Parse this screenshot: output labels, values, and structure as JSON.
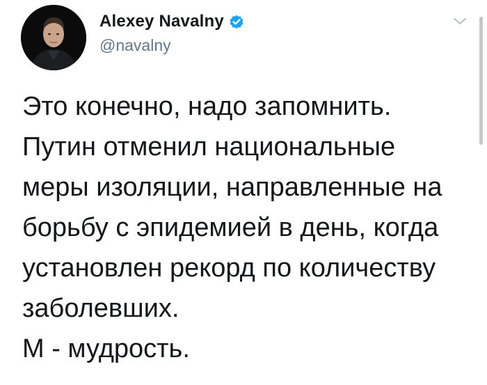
{
  "author": {
    "display_name": "Alexey Navalny",
    "handle": "@navalny",
    "verified": true
  },
  "icons": {
    "verified": "verified-badge-icon",
    "menu": "chevron-down-icon"
  },
  "colors": {
    "verified_blue": "#1da1f2",
    "handle_gray": "#657786",
    "text": "#14171a"
  },
  "tweet": {
    "lines": [
      "Это конечно, надо запомнить.",
      "Путин отменил национальные",
      "меры изоляции, направленные на",
      "борьбу с эпидемией в день, когда",
      "установлен рекорд по количеству",
      "заболевших.",
      "М - мудрость."
    ]
  }
}
